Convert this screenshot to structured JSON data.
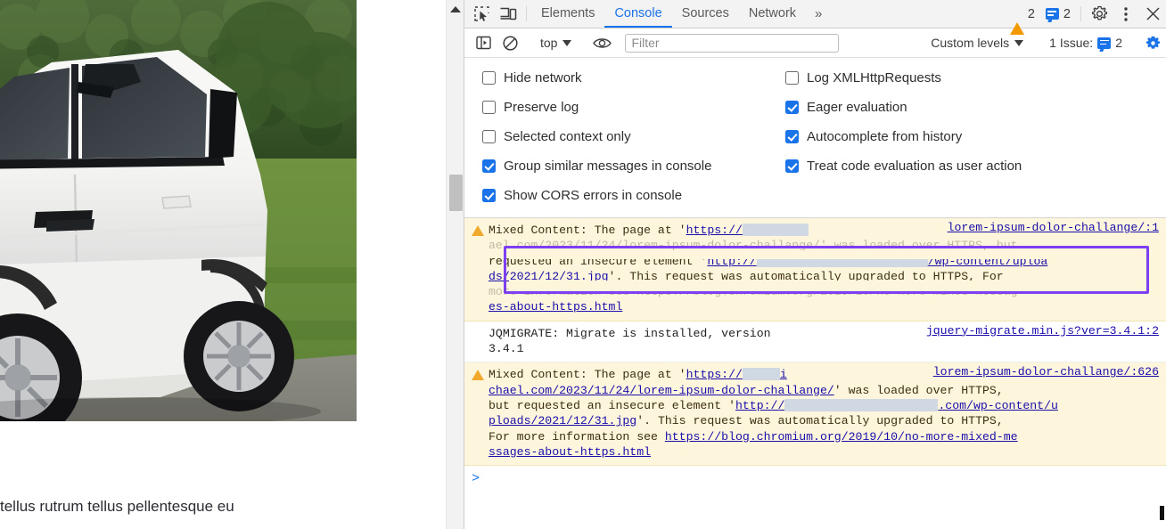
{
  "page": {
    "caption": "tellus rutrum tellus pellentesque eu",
    "photo_alt": "white-suv-parked-on-grass"
  },
  "scrollbar": {
    "up_arrow": "scroll-up"
  },
  "devtools": {
    "tabs": [
      {
        "label": "Elements",
        "active": false
      },
      {
        "label": "Console",
        "active": true
      },
      {
        "label": "Sources",
        "active": false
      },
      {
        "label": "Network",
        "active": false
      }
    ],
    "more_tabs": "»",
    "warning_count": "2",
    "message_count": "2",
    "icons": {
      "inspect": "inspect-element-icon",
      "device": "device-toolbar-icon",
      "settings": "gear-icon",
      "kebab": "more-options-icon",
      "close": "close-icon",
      "sidebar": "console-sidebar-icon",
      "clear": "clear-console-icon",
      "eye": "live-expression-icon",
      "settings_blue": "issues-settings-icon"
    },
    "filterbar": {
      "context": "top",
      "filter_placeholder": "Filter",
      "filter_value": "",
      "levels": "Custom levels",
      "issues_label": "1 Issue:",
      "issues_count": "2"
    },
    "settings_left": [
      {
        "label": "Hide network",
        "checked": false
      },
      {
        "label": "Preserve log",
        "checked": false
      },
      {
        "label": "Selected context only",
        "checked": false
      },
      {
        "label": "Group similar messages in console",
        "checked": true
      },
      {
        "label": "Show CORS errors in console",
        "checked": true
      }
    ],
    "settings_right": [
      {
        "label": "Log XMLHttpRequests",
        "checked": false
      },
      {
        "label": "Eager evaluation",
        "checked": true
      },
      {
        "label": "Autocomplete from history",
        "checked": true
      },
      {
        "label": "Treat code evaluation as user action",
        "checked": true
      }
    ],
    "console": {
      "entry1": {
        "level": "warning",
        "source": "lorem-ipsum-dolor-challange/:1",
        "line1_a": "Mixed Content: The page at '",
        "line1_link": "https://",
        "line2_faded": "ael.com/2023/11/24/lorem-ipsum-dolor-challange/' was loaded over HTTPS, but",
        "line3_a": "requested an insecure element '",
        "line3_link": "http://",
        "line3_tail": "/wp-content/uploa",
        "line4_link": "ds/2021/12/31.jpg",
        "line4_b": "'. This request was automatically upgraded to HTTPS, For",
        "line5_faded": "more information see https://blog.chromium.org/2019/10/no-more-mixed-messag",
        "line6_link": "es-about-https.html"
      },
      "entry2": {
        "level": "info",
        "source": "jquery-migrate.min.js?ver=3.4.1:2",
        "text_a": "JQMIGRATE: Migrate is installed, version ",
        "text_b": "3.4.1"
      },
      "entry3": {
        "level": "warning",
        "source": "lorem-ipsum-dolor-challange/:626",
        "line1_a": "Mixed Content: The page at '",
        "line1_link": "https://",
        "line2_link": "chael.com/2023/11/24/lorem-ipsum-dolor-challange/",
        "line2_b": "' was loaded over HTTPS,",
        "line3_a": "but requested an insecure element '",
        "line3_link": "http://",
        "line3_tail": ".com/wp-content/u",
        "line4_link": "ploads/2021/12/31.jpg",
        "line4_b": "'. This request was automatically upgraded to HTTPS,",
        "line5_a": "For more information see ",
        "line5_link": "https://blog.chromium.org/2019/10/no-more-mixed-me",
        "line6_link": "ssages-about-https.html"
      },
      "prompt": ">"
    },
    "highlight": {
      "color": "#7e3ff2"
    }
  },
  "colors": {
    "accent": "#1a73e8",
    "warning_bg": "#fdf6dd",
    "warning_icon": "#f0a92c",
    "link": "#1a0dab",
    "highlight": "#7e3ff2"
  }
}
